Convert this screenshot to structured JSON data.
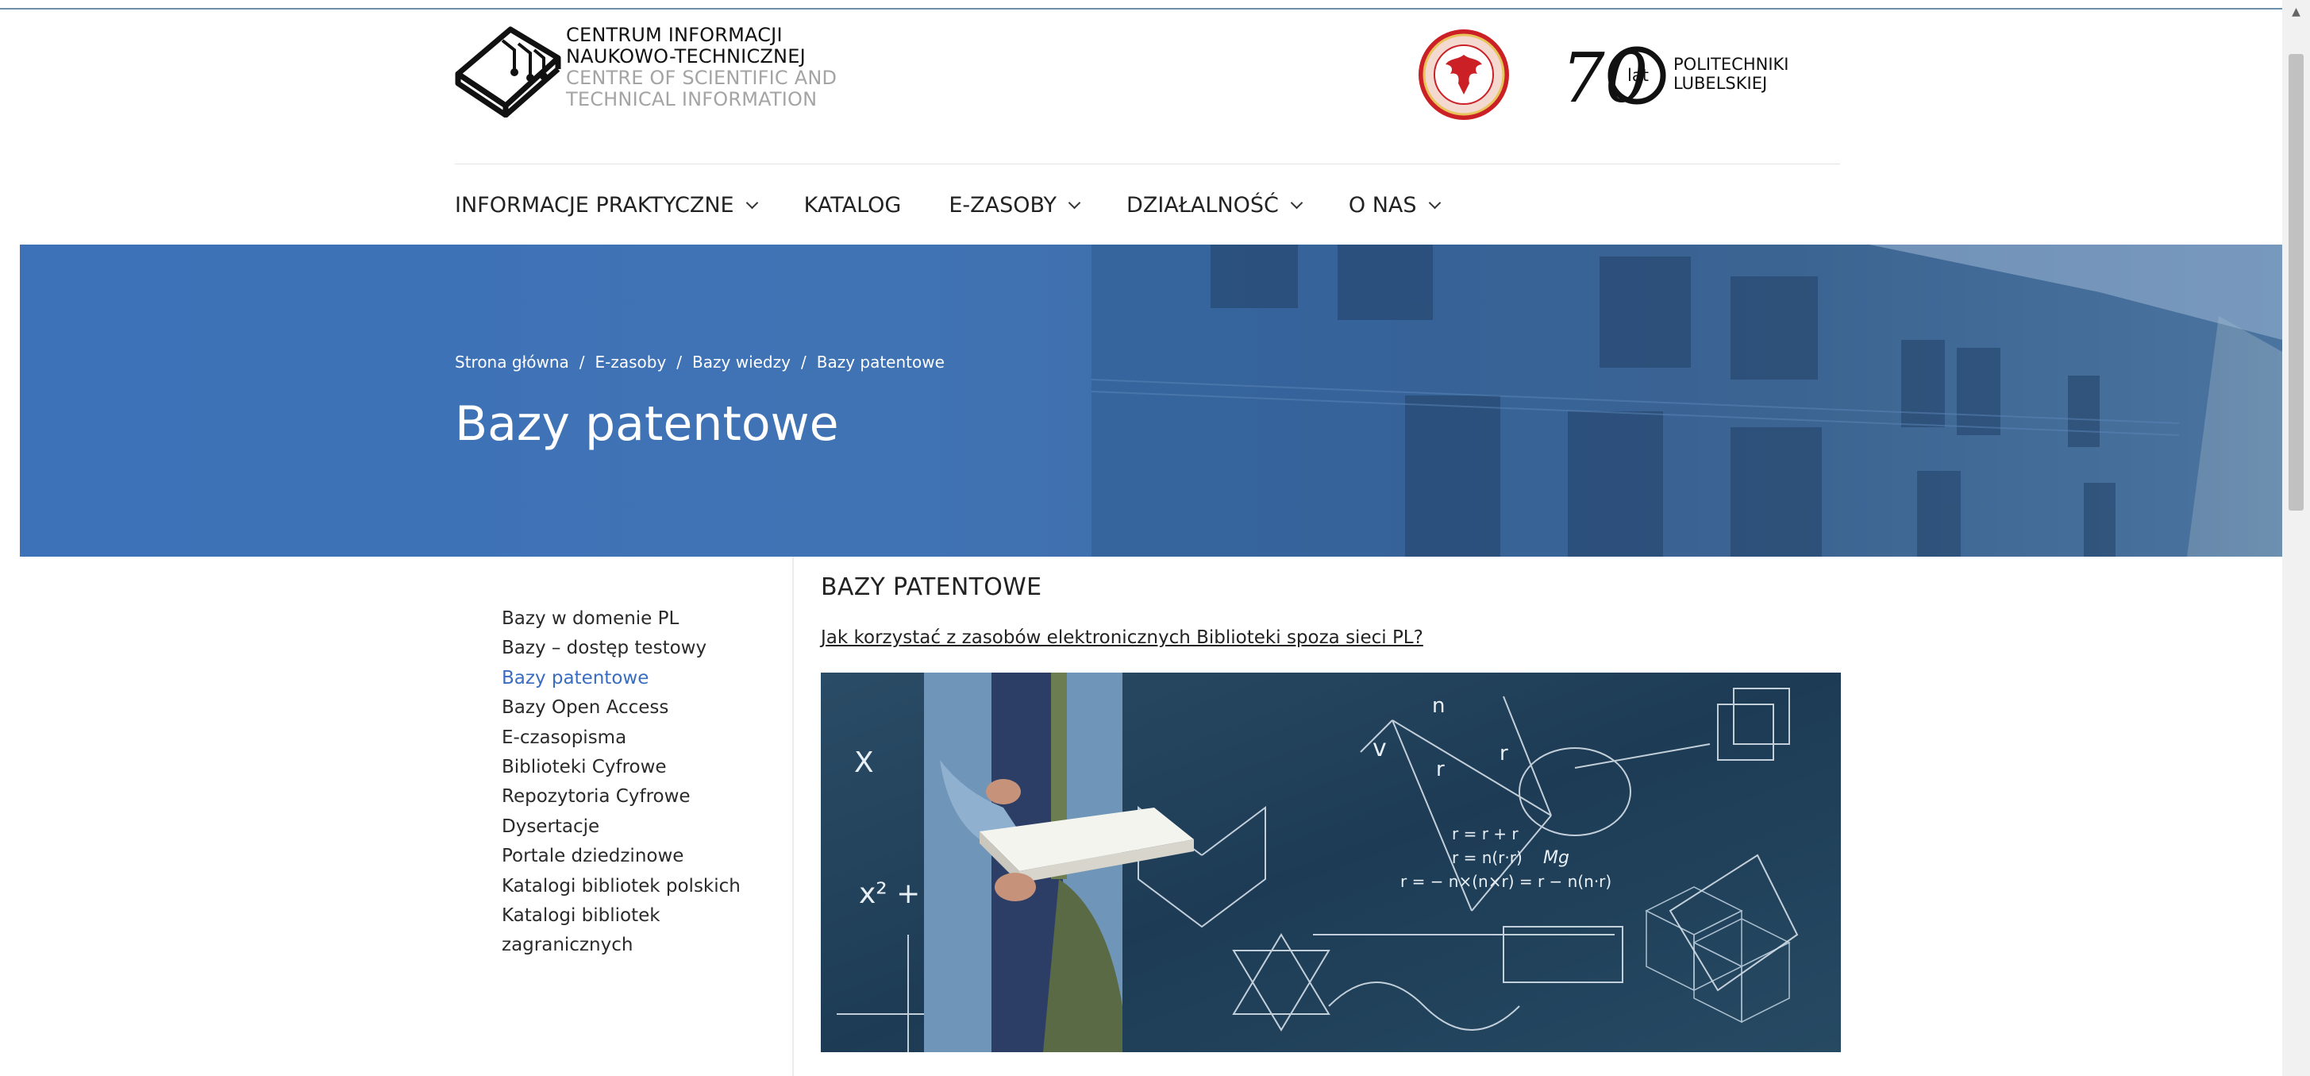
{
  "header": {
    "logo_line1": "CENTRUM INFORMACJI",
    "logo_line2": "NAUKOWO-TECHNICZNEJ",
    "logo_line3": "CENTRE OF SCIENTIFIC AND",
    "logo_line4": "TECHNICAL INFORMATION",
    "anniversary_number": "70",
    "anniversary_suffix": "lat",
    "anniversary_line1": "POLITECHNIKI",
    "anniversary_line2": "LUBELSKIEJ"
  },
  "nav": [
    {
      "label": "INFORMACJE PRAKTYCZNE",
      "dropdown": true
    },
    {
      "label": "KATALOG",
      "dropdown": false
    },
    {
      "label": "E-ZASOBY",
      "dropdown": true
    },
    {
      "label": "DZIAŁALNOŚĆ",
      "dropdown": true
    },
    {
      "label": "O NAS",
      "dropdown": true
    }
  ],
  "breadcrumb": [
    "Strona główna",
    "E-zasoby",
    "Bazy wiedzy",
    "Bazy patentowe"
  ],
  "breadcrumb_separator": "/",
  "page_title": "Bazy patentowe",
  "sidebar": [
    {
      "label": "Bazy w domenie PL",
      "active": false
    },
    {
      "label": "Bazy – dostęp testowy",
      "active": false
    },
    {
      "label": "Bazy patentowe",
      "active": true
    },
    {
      "label": "Bazy Open Access",
      "active": false
    },
    {
      "label": "E-czasopisma",
      "active": false
    },
    {
      "label": "Biblioteki Cyfrowe",
      "active": false
    },
    {
      "label": "Repozytoria Cyfrowe",
      "active": false
    },
    {
      "label": "Dysertacje",
      "active": false
    },
    {
      "label": "Portale dziedzinowe",
      "active": false
    },
    {
      "label": "Katalogi bibliotek polskich",
      "active": false
    },
    {
      "label": "Katalogi bibliotek",
      "active": false
    },
    {
      "label": "zagranicznych",
      "active": false
    }
  ],
  "content": {
    "section_title": "BAZY PATENTOWE",
    "link_text": "Jak korzystać z zasobów elektronicznych Biblioteki spoza sieci PL?",
    "image_formulas": [
      "n",
      "v",
      "r",
      "r",
      "r = r + r",
      "r = n(r·r)",
      "Mg",
      "r = − n×(n×r) = r − n(n·r)",
      "x² + p)",
      "X"
    ]
  },
  "colors": {
    "hero_blue": "#3d72b8",
    "active_link": "#3a6cc0",
    "image_bg": "#1f3f58",
    "emblem_red": "#cc2027"
  },
  "icons": [
    "circuit-book-logo-icon",
    "university-emblem-icon",
    "chevron-down-icon"
  ]
}
